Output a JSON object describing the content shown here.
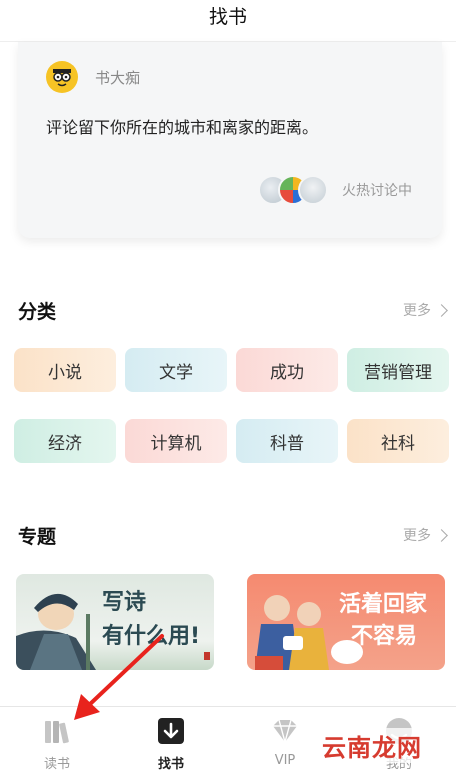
{
  "header": {
    "title": "找书"
  },
  "discussion": {
    "author": "书大痴",
    "comment": "评论留下你所在的城市和离家的距离。",
    "hot_label": "火热讨论中"
  },
  "categories": {
    "title": "分类",
    "more": "更多",
    "items": [
      "小说",
      "文学",
      "成功",
      "营销管理",
      "经济",
      "计算机",
      "科普",
      "社科"
    ]
  },
  "topics": {
    "title": "专题",
    "more": "更多",
    "cards": [
      {
        "line1": "写诗",
        "line2": "有什么用!"
      },
      {
        "line1": "活着回家",
        "line2": "不容易"
      }
    ]
  },
  "tabbar": {
    "items": [
      {
        "label": "读书",
        "icon": "bookshelf-icon"
      },
      {
        "label": "找书",
        "icon": "find-book-icon"
      },
      {
        "label": "VIP",
        "icon": "diamond-icon"
      },
      {
        "label": "我的",
        "icon": "profile-icon"
      }
    ],
    "active": "找书"
  },
  "watermark": "云南龙网",
  "colors": {
    "annotation_arrow": "#e8231d",
    "avatar_yellow": "#f6c325",
    "chip_orange": "#fbe2c8",
    "chip_blue": "#d5ecf2",
    "chip_pink": "#fbd9d6",
    "chip_green": "#cfeee3"
  }
}
